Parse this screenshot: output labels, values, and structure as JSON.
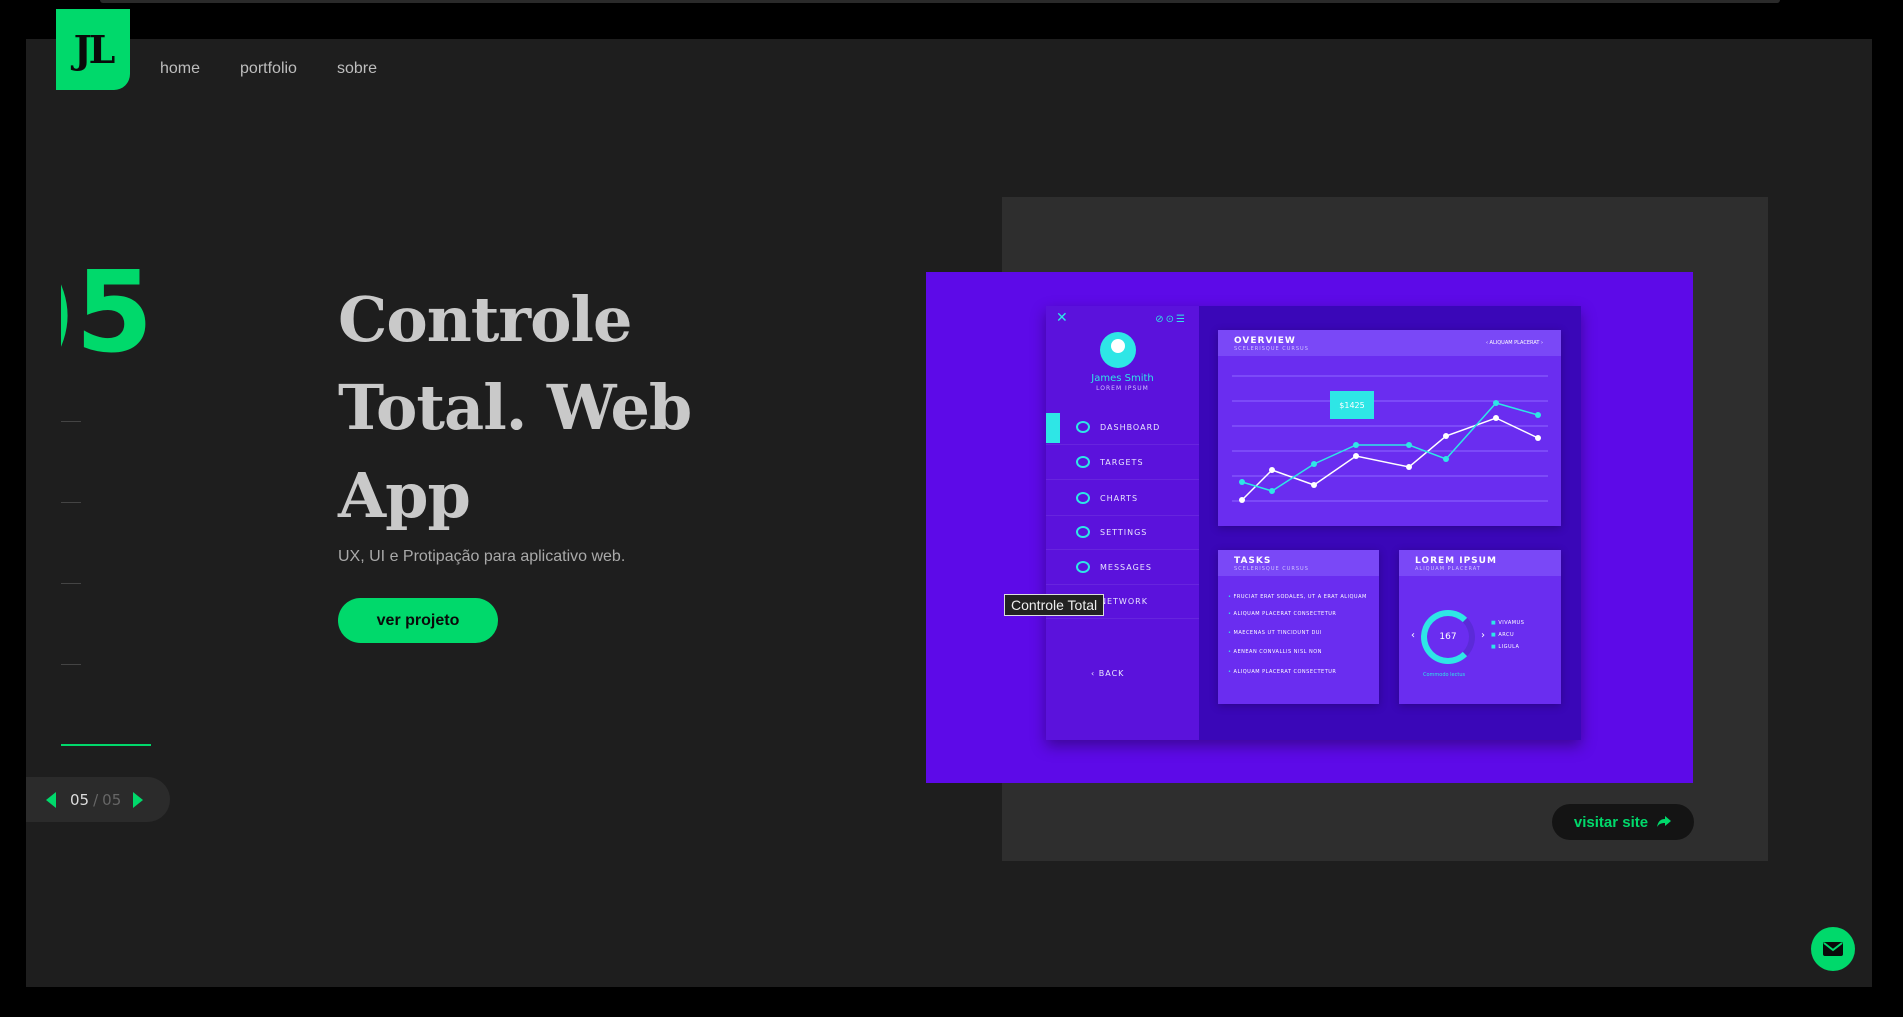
{
  "header": {
    "logo_text": "JL",
    "nav": [
      {
        "label": "home"
      },
      {
        "label": "portfolio"
      },
      {
        "label": "sobre"
      }
    ]
  },
  "slider": {
    "big_number": ")5",
    "pager": {
      "current": "05",
      "separator": "/",
      "total": "05"
    }
  },
  "project": {
    "title_lines": [
      "Controle",
      "Total. Web",
      "App"
    ],
    "subtitle": "UX, UI e Protipação para aplicativo web.",
    "cta_label": "ver projeto",
    "visit_label": "visitar site",
    "tooltip": "Controle Total"
  },
  "mock_dashboard": {
    "user_name": "James Smith",
    "user_role": "LOREM IPSUM",
    "menu": [
      {
        "label": "DASHBOARD"
      },
      {
        "label": "TARGETS"
      },
      {
        "label": "CHARTS"
      },
      {
        "label": "SETTINGS"
      },
      {
        "label": "MESSAGES"
      },
      {
        "label": "NETWORK"
      }
    ],
    "back_label": "BACK",
    "overview": {
      "title": "OVERVIEW",
      "subtitle": "SCELERISQUE CURSUS",
      "nav_label": "ALIQUAM PLACERAT",
      "price": "$1425"
    },
    "tasks": {
      "title": "TASKS",
      "subtitle": "SCELERISQUE CURSUS",
      "items": [
        "FRUCIAT ERAT SODALES, UT A ERAT ALIQUAM",
        "ALIQUAM PLACERAT CONSECTETUR",
        "MAECENAS UT TINCIDUNT DUI",
        "AENEAN CONVALLIS NISL NON",
        "ALIQUAM PLACERAT CONSECTETUR"
      ]
    },
    "lorem": {
      "title": "LOREM IPSUM",
      "subtitle": "ALIQUAM PLACERAT",
      "donut_value": "167",
      "caption": "Commodo lectus",
      "legend": [
        "VIVAMUS",
        "ARCU",
        "LIGULA"
      ]
    }
  },
  "colors": {
    "accent": "#00d96b",
    "background": "#1e1e1e",
    "mock_purple": "#5d0ae8",
    "mock_cyan": "#2ee6e6"
  },
  "icons": {
    "pager_prev": "triangle-left-icon",
    "pager_next": "triangle-right-icon",
    "visit": "share-arrow-icon",
    "mail": "envelope-icon"
  }
}
